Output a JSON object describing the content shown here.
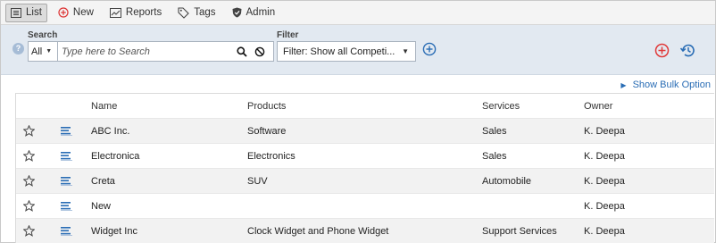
{
  "nav": {
    "items": [
      {
        "label": "List",
        "icon": "list-icon",
        "active": true
      },
      {
        "label": "New",
        "icon": "plus-circle-icon",
        "active": false
      },
      {
        "label": "Reports",
        "icon": "chart-icon",
        "active": false
      },
      {
        "label": "Tags",
        "icon": "tag-icon",
        "active": false
      },
      {
        "label": "Admin",
        "icon": "shield-icon",
        "active": false
      }
    ]
  },
  "search": {
    "label": "Search",
    "scope": "All",
    "placeholder": "Type here to Search"
  },
  "filter": {
    "label": "Filter",
    "value": "Filter:  Show all Competi..."
  },
  "help_glyph": "?",
  "bulk_option": "Show Bulk Option",
  "table": {
    "columns": [
      "Name",
      "Products",
      "Services",
      "Owner"
    ],
    "rows": [
      {
        "name": "ABC Inc.",
        "products": "Software",
        "services": "Sales",
        "owner": "K. Deepa"
      },
      {
        "name": "Electronica",
        "products": "Electronics",
        "services": "Sales",
        "owner": "K. Deepa"
      },
      {
        "name": "Creta",
        "products": "SUV",
        "services": "Automobile",
        "owner": "K. Deepa"
      },
      {
        "name": "New",
        "products": "",
        "services": "",
        "owner": "K. Deepa"
      },
      {
        "name": "Widget Inc",
        "products": "Clock Widget and Phone Widget",
        "services": "Support Services",
        "owner": "K. Deepa"
      }
    ]
  },
  "colors": {
    "accent_blue": "#2a6db5",
    "add_red": "#e03a3a",
    "filter_bar_bg": "#e2e9f1"
  }
}
